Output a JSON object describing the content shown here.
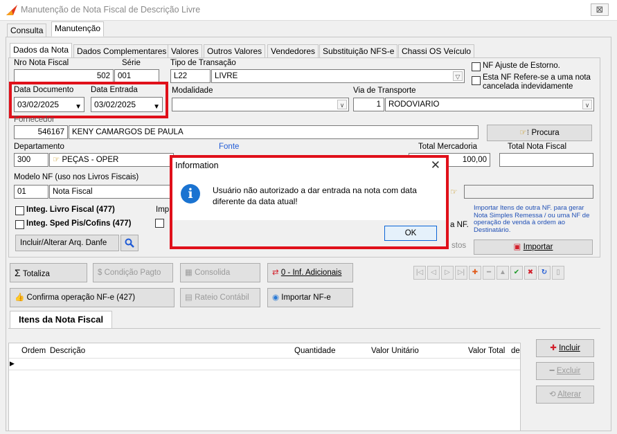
{
  "window": {
    "title": "Manutenção de Nota Fiscal de Descrição Livre",
    "close_glyph": "⊠"
  },
  "top_tabs": [
    "Consulta",
    "Manutenção"
  ],
  "sub_tabs": [
    "Dados da Nota",
    "Dados Complementares",
    "Valores",
    "Outros Valores",
    "Vendedores",
    "Substituição NFS-e",
    "Chassi OS Veículo"
  ],
  "form": {
    "nro_nf_label": "Nro Nota Fiscal",
    "nro_nf_value": "502",
    "serie_label": "Série",
    "serie_value": "001",
    "tipo_transacao_label": "Tipo de Transação",
    "tipo_code": "L22",
    "tipo_value": "LIVRE",
    "nf_ajuste_label": "NF Ajuste de Estorno.",
    "nf_refere_label": "Esta NF Refere-se a uma nota cancelada indevidamente",
    "data_doc_label": "Data Documento",
    "data_doc_value": "03/02/2025",
    "data_entrada_label": "Data Entrada",
    "data_entrada_value": "03/02/2025",
    "modalidade_label": "Modalidade",
    "modalidade_value": "",
    "via_label": "Via de Transporte",
    "via_code": "1",
    "via_value": "RODOVIARIO",
    "fornecedor_label": "Fornecedor",
    "fornecedor_code": "546167",
    "fornecedor_name": "KENY CAMARGOS DE PAULA",
    "procura_label": "Procura",
    "departamento_label": "Departamento",
    "dept_code": "300",
    "dept_name": "PEÇAS - OPER",
    "fonte_label": "Fonte",
    "total_merc_label": "Total Mercadoria",
    "total_merc_value": "100,00",
    "total_nf_label": "Total Nota Fiscal",
    "total_nf_value": "",
    "modelo_label": "Modelo NF (uso nos Livros Fiscais)",
    "modelo_code": "01",
    "modelo_name": "Nota Fiscal",
    "integ_livro_label": "Integ. Livro Fiscal (477)",
    "integ_sped_label": "Integ. Sped Pis/Cofins (477)",
    "imp_partial": "Imp",
    "a_nf_partial": "a NF.",
    "stos_partial": "stos",
    "importar_info": "Importar Itens de outra NF. para gerar Nota Simples Remessa / ou uma NF de operação de venda à ordem ao Destinatário.",
    "importar_label": "Importar",
    "incluir_danfe_label": "Incluir/Alterar Arq. Danfe"
  },
  "toolbar": {
    "totaliza": "Totaliza",
    "condicao": "Condição Pagto",
    "consolida": "Consolida",
    "inf_adicionais": "0 - Inf. Adicionais",
    "confirma": "Confirma operação NF-e (427)",
    "rateio": "Rateio Contábil",
    "importar_nfe": "Importar NF-e"
  },
  "items": {
    "tab_label": "Itens da Nota Fiscal",
    "columns": [
      "Ordem",
      "Descrição",
      "Quantidade",
      "Valor Unitário",
      "Valor Total",
      "de"
    ],
    "incluir": "Incluir",
    "excluir": "Excluir",
    "alterar": "Alterar"
  },
  "dialog": {
    "title": "Information",
    "message_line1": "Usuário não autorizado a dar entrada na nota com data",
    "message_line2": "diferente da data atual!",
    "ok": "OK"
  },
  "colors": {
    "highlight": "#e0101a",
    "info_blue": "#1a73d1"
  }
}
